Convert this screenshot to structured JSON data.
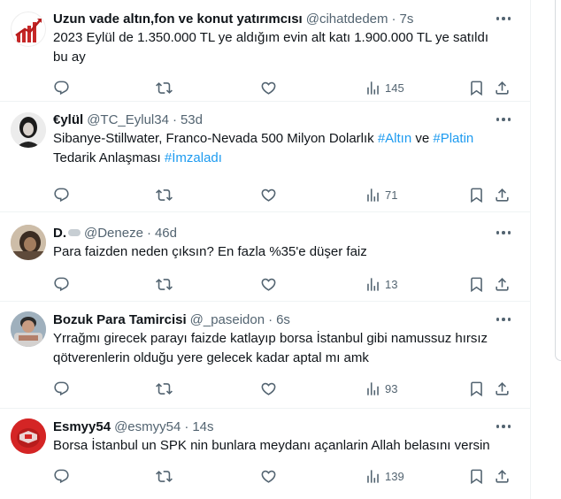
{
  "tweets": [
    {
      "name": "Uzun vade altın,fon ve konut yatırımcısı",
      "handle": "@cihatdedem",
      "time": "7s",
      "line1": "2023 Eylül de 1.350.000 TL ye aldığım evin alt katı 1.900.000 TL ye satıldı",
      "line2": "bu ay",
      "views": "145"
    },
    {
      "name": "€ylül",
      "handle": "@TC_Eylul34",
      "time": "53d",
      "l1_pre": "Sibanye-Stillwater, Franco-Nevada 500 Milyon Dolarlık ",
      "tag1": "#Altın",
      "l1_mid": " ve ",
      "tag2": "#Platin",
      "l2_pre": "Tedarik Anlaşması ",
      "tag3": "#İmzaladı",
      "views": "71"
    },
    {
      "name": "D.",
      "handle": "@Deneze",
      "time": "46d",
      "line1": "Para faizden neden çıksın? En fazla %35'e düşer faiz",
      "views": "13"
    },
    {
      "name": "Bozuk Para Tamircisi",
      "handle": "@_paseidon",
      "time": "6s",
      "line1": "Yrrağmı girecek parayı faizde katlayıp borsa İstanbul gibi namussuz hırsız",
      "line2": "qötverenlerin olduğu yere gelecek kadar aptal mı amk",
      "views": "93"
    },
    {
      "name": "Esmyy54",
      "handle": "@esmyy54",
      "time": "14s",
      "line1": "Borsa İstanbul un SPK nin bunlara meydanı açanlarin Allah belasını versin",
      "views": "139"
    }
  ],
  "colors": {
    "link": "#1d9bf0",
    "secondary": "#536471",
    "text": "#0f1419",
    "divider": "#eff3f4"
  },
  "icons": [
    "reply-icon",
    "retweet-icon",
    "like-icon",
    "views-icon",
    "bookmark-icon",
    "share-icon",
    "more-icon"
  ]
}
